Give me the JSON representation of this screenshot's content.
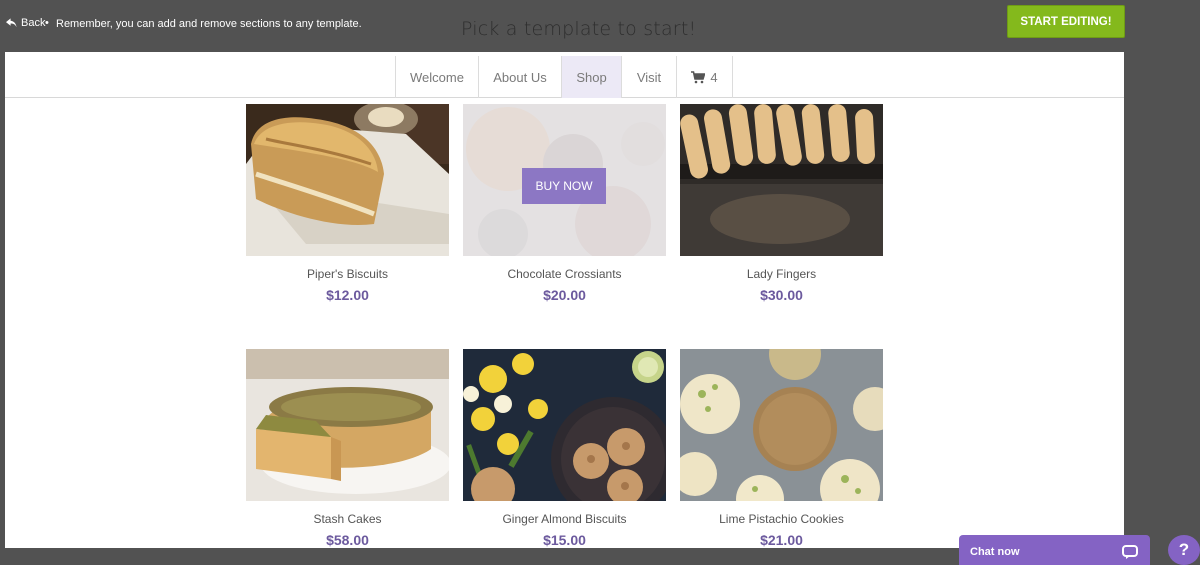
{
  "topbar": {
    "back_label": "Back",
    "separator": "•",
    "reminder": "Remember, you can add and remove sections to any template.",
    "title": "Pick a template to start!",
    "start_editing": "START EDITING!"
  },
  "nav": {
    "items": [
      {
        "label": "Welcome"
      },
      {
        "label": "About Us"
      },
      {
        "label": "Shop",
        "active": true
      },
      {
        "label": "Visit"
      }
    ],
    "cart_count": "4"
  },
  "products": [
    {
      "name": "Piper's Biscuits",
      "price": "$12.00"
    },
    {
      "name": "Chocolate Crossiants",
      "price": "$20.00",
      "button": "BUY NOW"
    },
    {
      "name": "Lady Fingers",
      "price": "$30.00"
    },
    {
      "name": "Stash Cakes",
      "price": "$58.00"
    },
    {
      "name": "Ginger Almond Biscuits",
      "price": "$15.00"
    },
    {
      "name": "Lime Pistachio Cookies",
      "price": "$21.00"
    }
  ],
  "chat": {
    "label": "Chat now"
  },
  "help": {
    "label": "?"
  },
  "colors": {
    "accent": "#8463c4",
    "price": "#6c5a9e",
    "start_button": "#84b91c"
  }
}
